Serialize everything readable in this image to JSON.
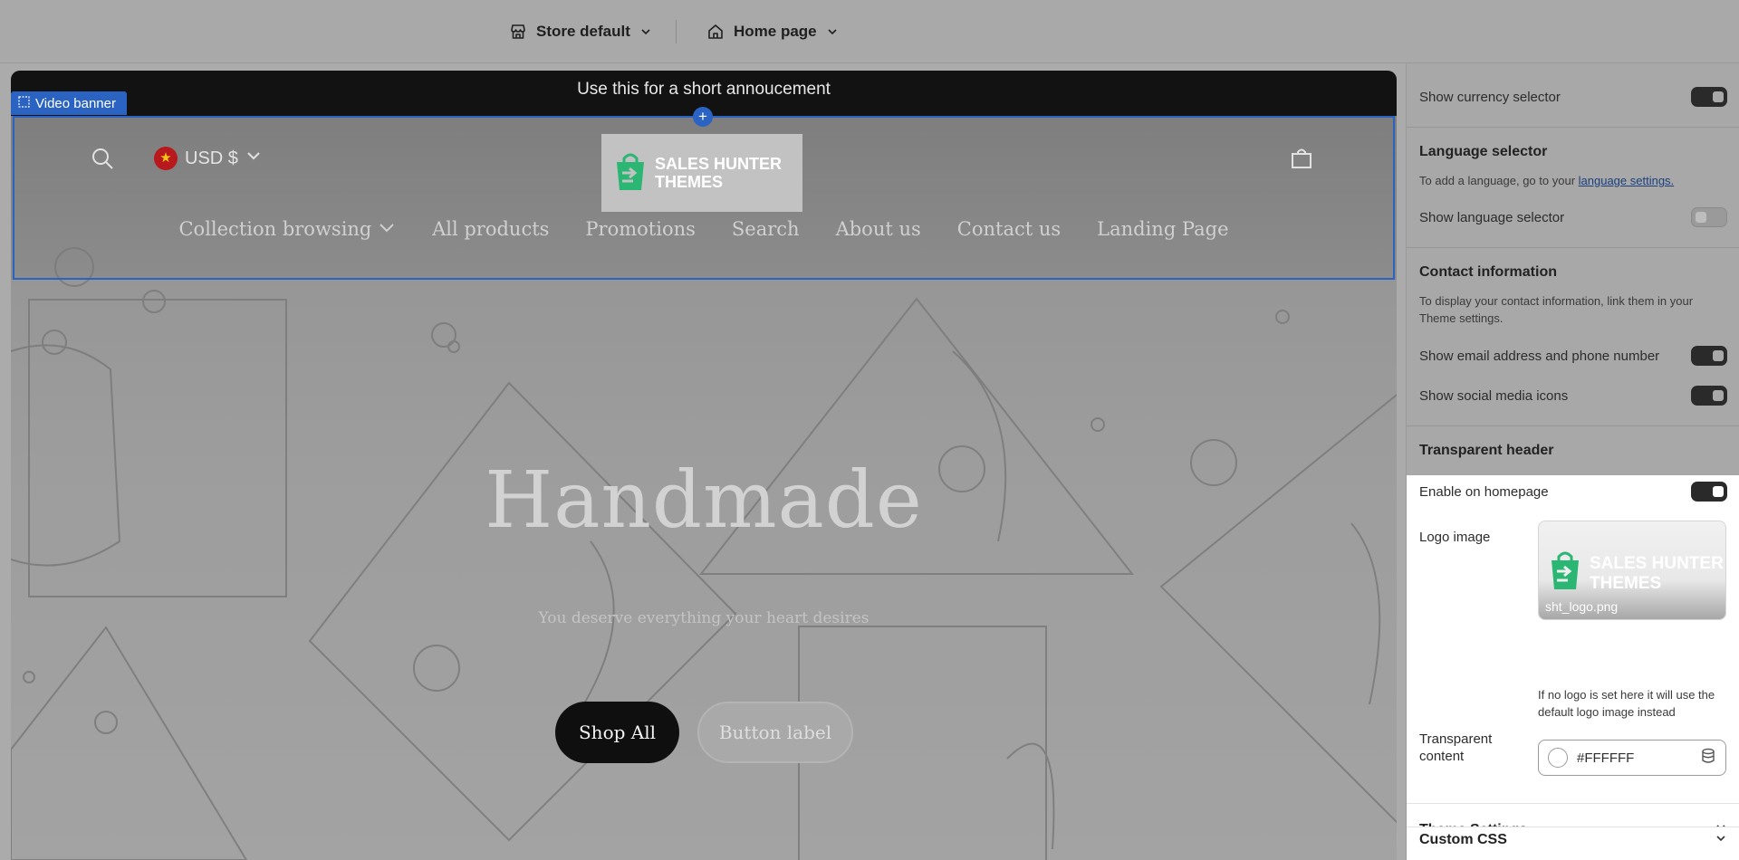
{
  "topbar": {
    "store_label": "Store default",
    "page_label": "Home page"
  },
  "preview": {
    "announcement": "Use this for a short annoucement",
    "section_tag": "Video banner",
    "currency": "USD $",
    "logo_text": "SALES HUNTER THEMES",
    "nav": [
      "Collection browsing",
      "All products",
      "Promotions",
      "Search",
      "About us",
      "Contact us",
      "Landing Page"
    ],
    "hero_title": "Handmade",
    "hero_subtitle": "You deserve everything your heart desires",
    "primary_button": "Shop All",
    "secondary_button": "Button label"
  },
  "sidebar": {
    "show_currency_selector": {
      "label": "Show currency selector",
      "enabled": true
    },
    "language_heading": "Language selector",
    "language_help_prefix": "To add a language, go to your ",
    "language_help_link": "language settings.",
    "show_language_selector": {
      "label": "Show language selector",
      "enabled": false
    },
    "contact_heading": "Contact information",
    "contact_help": "To display your contact information, link them in your Theme settings.",
    "show_email_phone": {
      "label": "Show email address and phone number",
      "enabled": true
    },
    "show_social_icons": {
      "label": "Show social media icons",
      "enabled": true
    },
    "transparent_heading": "Transparent header",
    "enable_on_homepage": {
      "label": "Enable on homepage",
      "enabled": true
    },
    "logo_image_label": "Logo image",
    "logo_image_brand": "SALES HUNTER THEMES",
    "logo_filename": "sht_logo.png",
    "logo_help": "If no logo is set here it will use the default logo image instead",
    "transparent_content_label": "Transparent content",
    "transparent_color": "#FFFFFF",
    "accordion_theme_settings": "Theme Settings",
    "accordion_custom_css": "Custom CSS"
  },
  "colors": {
    "selection_blue": "#2a63c2",
    "brand_green": "#2bb673",
    "announcement_bg": "#121212"
  }
}
